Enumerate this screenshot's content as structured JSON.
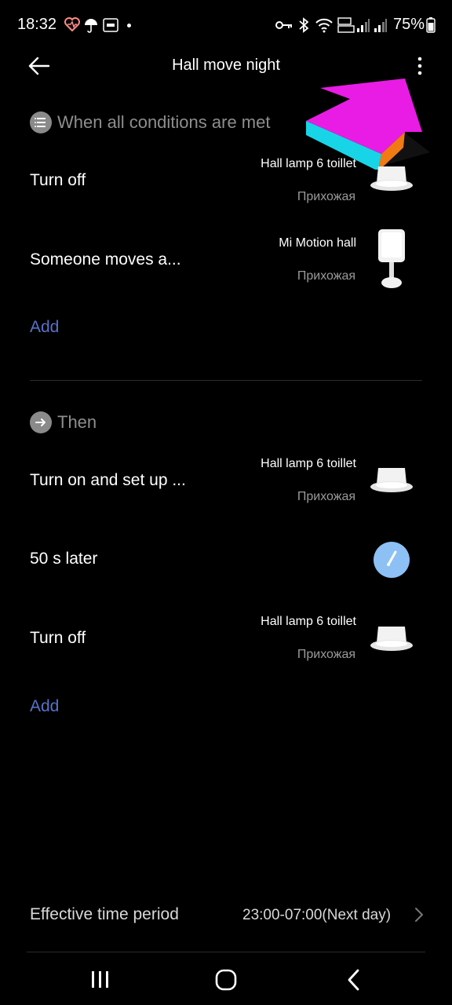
{
  "status_bar": {
    "time": "18:32",
    "battery": "75%"
  },
  "header": {
    "title": "Hall move night"
  },
  "conditions": {
    "header": "When all conditions are met",
    "items": [
      {
        "action": "Turn off",
        "device": "Hall lamp 6 toillet",
        "room": "Прихожая",
        "icon": "ceiling-lamp-icon"
      },
      {
        "action": "Someone moves a...",
        "device": "Mi Motion hall",
        "room": "Прихожая",
        "icon": "motion-sensor-icon"
      }
    ],
    "add_label": "Add"
  },
  "actions": {
    "header": "Then",
    "items": [
      {
        "action": "Turn on and set up ...",
        "device": "Hall lamp 6 toillet",
        "room": "Прихожая",
        "icon": "ceiling-lamp-icon"
      },
      {
        "action": "50 s later",
        "icon": "timer-icon"
      },
      {
        "action": "Turn off",
        "device": "Hall lamp 6 toillet",
        "room": "Прихожая",
        "icon": "ceiling-lamp-icon"
      }
    ],
    "add_label": "Add"
  },
  "effective_time": {
    "label": "Effective time period",
    "value": "23:00-07:00(Next day)"
  },
  "colors": {
    "accent": "#5573c8",
    "background": "#000000",
    "secondary_text": "#9a9a9a"
  }
}
